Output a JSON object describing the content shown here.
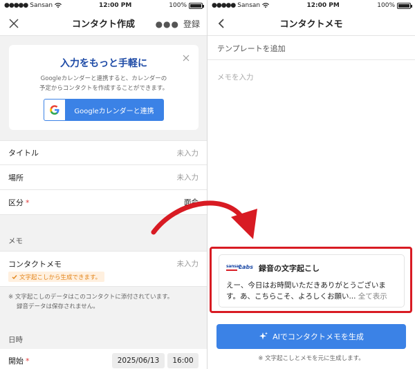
{
  "colors": {
    "accent": "#3b82e6",
    "title_blue": "#1d4aa6",
    "required": "#e03a3a",
    "highlight": "#d81b23",
    "badge_text": "#e3851a"
  },
  "left": {
    "status": {
      "carrier": "Sansan",
      "time": "12:00 PM",
      "battery": "100%"
    },
    "nav": {
      "title": "コンタクト作成",
      "close_icon": "close-icon",
      "more_icon": "more-dots-icon",
      "register": "登録"
    },
    "banner": {
      "title": "入力をもっと手軽に",
      "desc_line1": "Googleカレンダーと連携すると、カレンダーの",
      "desc_line2": "予定からコンタクトを作成することができます。",
      "button": "Googleカレンダーと連携"
    },
    "fields": [
      {
        "label": "タイトル",
        "value": "未入力",
        "required": false
      },
      {
        "label": "場所",
        "value": "未入力",
        "required": false
      },
      {
        "label": "区分",
        "value": "面会",
        "required": true
      }
    ],
    "memo_section": "メモ",
    "memo": {
      "label": "コンタクトメモ",
      "value": "未入力",
      "badge": "文字起こしから生成できます。"
    },
    "note_line1": "※ 文字起こしのデータはこのコンタクトに添付されています。",
    "note_line2": "録音データは保存されません。",
    "datetime_section": "日時",
    "start": {
      "label": "開始",
      "date": "2025/06/13",
      "time": "16:00"
    }
  },
  "right": {
    "status": {
      "carrier": "Sansan",
      "time": "12:00 PM",
      "battery": "100%"
    },
    "nav": {
      "title": "コンタクトメモ",
      "back_icon": "chevron-left-icon"
    },
    "template_placeholder": "テンプレートを追加",
    "memo_placeholder": "メモを入力",
    "transcript": {
      "logo_sansan": "sansan",
      "logo_labs": "Labs",
      "title": "録音の文字起こし",
      "line1": "えー、今日はお時間いただきありがとうございま",
      "line2": "す。あ、こちらこそ、よろしくお願い...",
      "more": " 全て表示"
    },
    "ai_button": "AIでコンタクトメモを生成",
    "ai_note": "※ 文字起こしとメモを元に生成します。"
  }
}
